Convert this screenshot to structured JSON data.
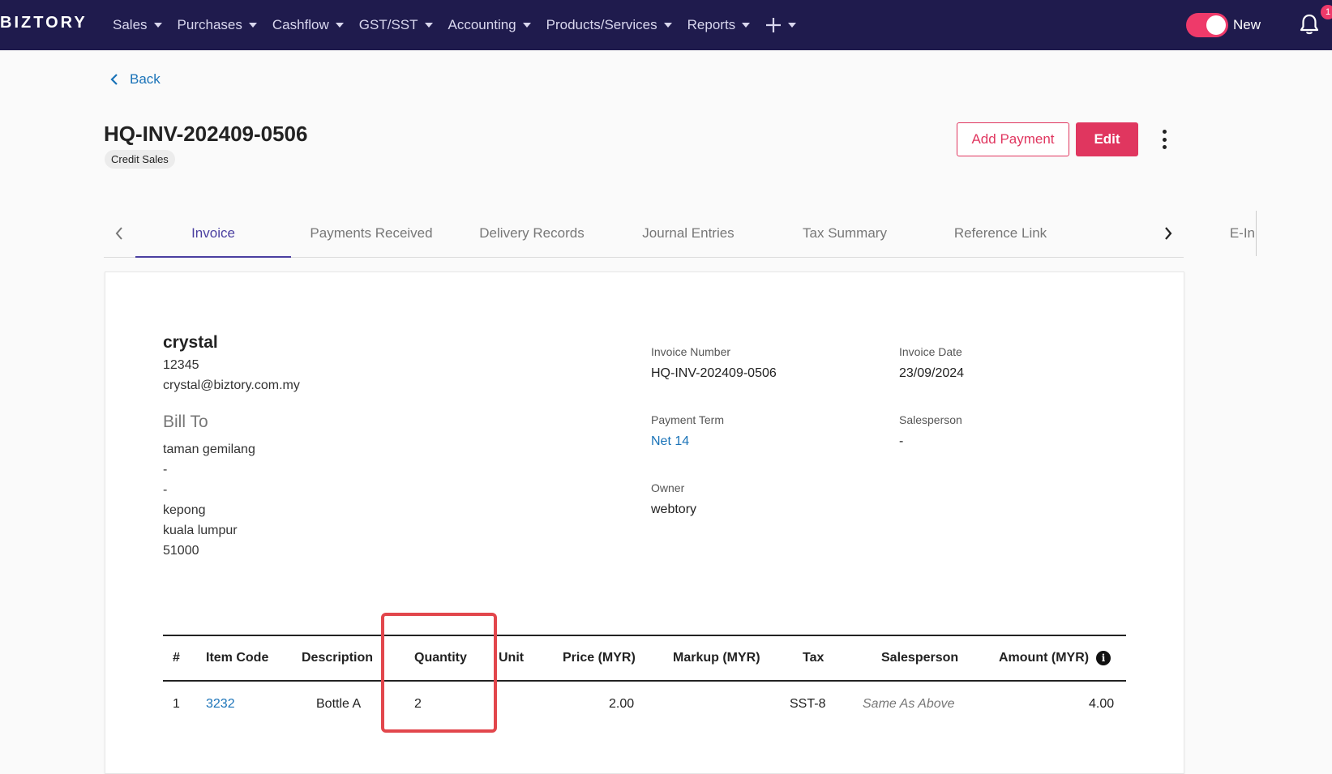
{
  "nav": {
    "brand": "BIZTORY",
    "menu": [
      "Sales",
      "Purchases",
      "Cashflow",
      "GST/SST",
      "Accounting",
      "Products/Services",
      "Reports"
    ],
    "toggle_label": "New",
    "notification_count": "1",
    "accent": "#ee3a6a",
    "bg": "#1f1b4d"
  },
  "header": {
    "back_label": "Back",
    "title": "HQ-INV-202409-0506",
    "chip": "Credit Sales",
    "add_payment_label": "Add Payment",
    "edit_label": "Edit"
  },
  "tabs": [
    "Invoice",
    "Payments Received",
    "Delivery Records",
    "Journal Entries",
    "Tax Summary",
    "Reference Link",
    "E-In"
  ],
  "customer": {
    "name": "crystal",
    "phone": "12345",
    "email": "crystal@biztory.com.my",
    "bill_to_label": "Bill To",
    "address": [
      "taman gemilang",
      "-",
      "-",
      "kepong",
      "kuala lumpur",
      "51000"
    ]
  },
  "meta": {
    "invoice_number_label": "Invoice Number",
    "invoice_number": "HQ-INV-202409-0506",
    "invoice_date_label": "Invoice Date",
    "invoice_date": "23/09/2024",
    "payment_term_label": "Payment Term",
    "payment_term": "Net 14",
    "salesperson_label": "Salesperson",
    "salesperson": "-",
    "owner_label": "Owner",
    "owner": "webtory"
  },
  "table": {
    "headers": [
      "#",
      "Item Code",
      "Description",
      "Quantity",
      "Unit",
      "Price (MYR)",
      "Markup (MYR)",
      "Tax",
      "Salesperson",
      "Amount (MYR)"
    ],
    "rows": [
      [
        "1",
        "3232",
        "Bottle A",
        "2",
        "",
        "2.00",
        "",
        "SST-8",
        "Same As Above",
        "4.00"
      ]
    ]
  }
}
